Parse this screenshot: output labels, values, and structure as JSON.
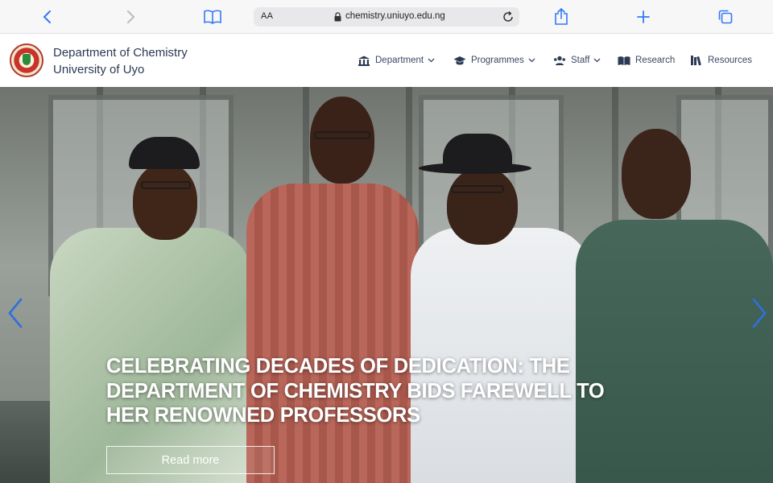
{
  "browser": {
    "text_size_label": "AA",
    "url": "chemistry.uniuyo.edu.ng"
  },
  "header": {
    "title_line1": "Department of Chemistry",
    "title_line2": "University of Uyo",
    "nav": [
      {
        "label": "Department",
        "icon": "building-icon",
        "dropdown": true
      },
      {
        "label": "Programmes",
        "icon": "graduation-cap-icon",
        "dropdown": true
      },
      {
        "label": "Staff",
        "icon": "users-icon",
        "dropdown": true
      },
      {
        "label": "Research",
        "icon": "open-book-icon",
        "dropdown": false
      },
      {
        "label": "Resources",
        "icon": "library-icon",
        "dropdown": false
      }
    ]
  },
  "hero": {
    "headline": "CELEBRATING DECADES OF DEDICATION: THE DEPARTMENT OF CHEMISTRY BIDS FAREWELL TO HER RENOWNED PROFESSORS",
    "cta_label": "Read more"
  },
  "colors": {
    "accent": "#2b3a55",
    "nav_text": "#3b4a66",
    "browser_icon": "#3478f6",
    "carousel_arrow": "#2f6fde"
  }
}
